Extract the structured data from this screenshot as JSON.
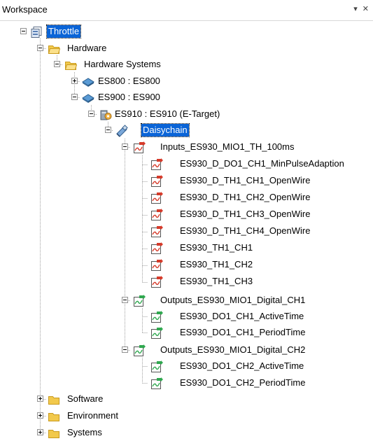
{
  "panel": {
    "title": "Workspace",
    "buttons": "▾ ✕"
  },
  "tree": {
    "root": "Throttle",
    "hardware": "Hardware",
    "hardware_systems": "Hardware Systems",
    "es800": "ES800 : ES800",
    "es900": "ES900 : ES900",
    "es910": "ES910 : ES910 (E-Target)",
    "daisychain": "Daisychain",
    "inputs_group": "Inputs_ES930_MIO1_TH_100ms",
    "inputs": [
      "ES930_D_DO1_CH1_MinPulseAdaption",
      "ES930_D_TH1_CH1_OpenWire",
      "ES930_D_TH1_CH2_OpenWire",
      "ES930_D_TH1_CH3_OpenWire",
      "ES930_D_TH1_CH4_OpenWire",
      "ES930_TH1_CH1",
      "ES930_TH1_CH2",
      "ES930_TH1_CH3"
    ],
    "outputs1_group": "Outputs_ES930_MIO1_Digital_CH1",
    "outputs1": [
      "ES930_DO1_CH1_ActiveTime",
      "ES930_DO1_CH1_PeriodTime"
    ],
    "outputs2_group": "Outputs_ES930_MIO1_Digital_CH2",
    "outputs2": [
      "ES930_DO1_CH2_ActiveTime",
      "ES930_DO1_CH2_PeriodTime"
    ],
    "software": "Software",
    "environment": "Environment",
    "systems": "Systems"
  },
  "colors": {
    "selection": "#0a64d7",
    "folder": "#f2c94c",
    "input_arrow": "#d63a2a",
    "output_arrow": "#2fa84f"
  }
}
